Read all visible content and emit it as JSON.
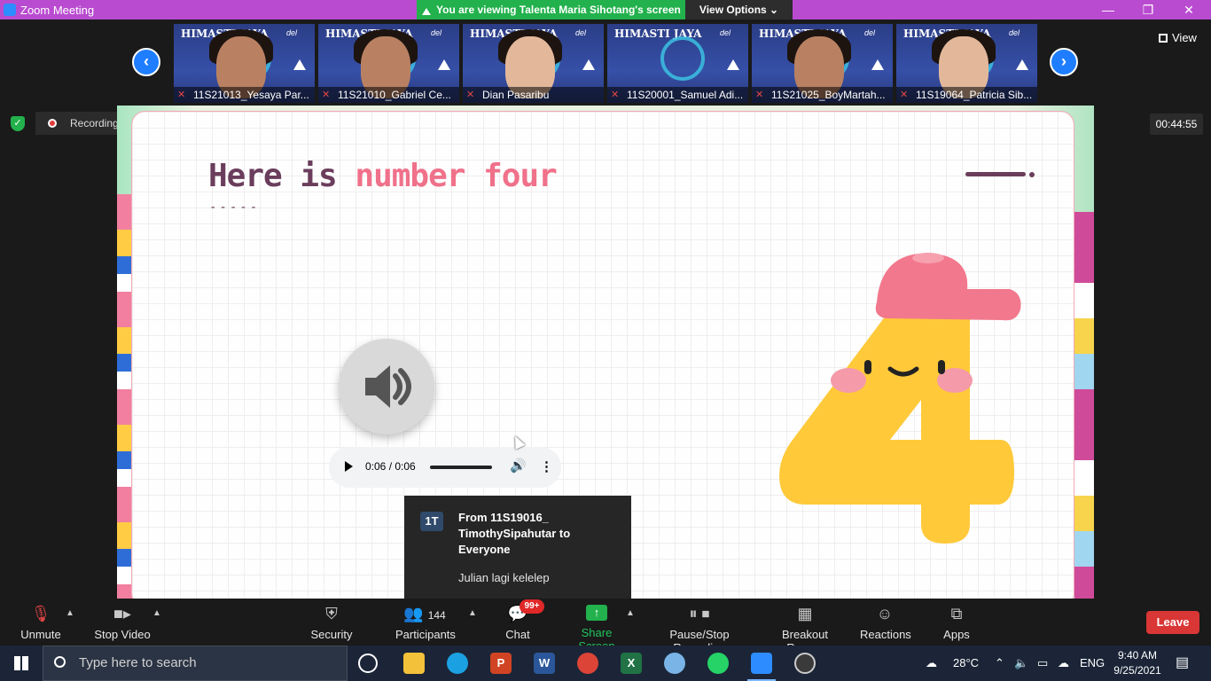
{
  "window": {
    "title": "Zoom Meeting"
  },
  "banner": {
    "sharing_text": "You are viewing Talenta Maria Sihotang's screen",
    "view_options": "View Options ⌄"
  },
  "view": {
    "label": "View"
  },
  "participants_strip": [
    {
      "name": "11S21013_Yesaya Par...",
      "has_person": true,
      "tone": "dark"
    },
    {
      "name": "11S21010_Gabriel Ce...",
      "has_person": true,
      "tone": "dark"
    },
    {
      "name": "Dian Pasaribu",
      "has_person": true,
      "tone": "light"
    },
    {
      "name": "11S20001_Samuel Adi...",
      "has_person": false,
      "tone": "none"
    },
    {
      "name": "11S21025_BoyMartah...",
      "has_person": true,
      "tone": "dark"
    },
    {
      "name": "11S19064_Patricia Sib...",
      "has_person": true,
      "tone": "light"
    }
  ],
  "thumb_brand": "HIMASTI JAYA",
  "thumb_del": "del",
  "recording": {
    "label": "Recording...",
    "timer": "00:44:55"
  },
  "slide": {
    "title_prefix": "Here is",
    "title_accent": "number four",
    "dashes": "-----",
    "audio": {
      "time": "0:06 / 0:06"
    }
  },
  "chat_popup": {
    "avatar": "1T",
    "from": "From 11S19016_ TimothySipahutar to Everyone",
    "message": "Julian lagi kelelep"
  },
  "toolbar": {
    "unmute": "Unmute",
    "stop_video": "Stop Video",
    "security": "Security",
    "participants": "Participants",
    "participants_count": "144",
    "chat": "Chat",
    "chat_badge": "99+",
    "share_screen": "Share Screen",
    "pause_stop_recording": "Pause/Stop Recording",
    "breakout_rooms": "Breakout Rooms",
    "reactions": "Reactions",
    "apps": "Apps",
    "leave": "Leave"
  },
  "taskbar": {
    "search_placeholder": "Type here to search",
    "weather": "28°C",
    "language": "ENG",
    "time": "9:40 AM",
    "date": "9/25/2021"
  },
  "colors": {
    "titlebar": "#b94bd0",
    "share_green": "#22b14c",
    "leave_red": "#d93636",
    "slide_title": "#6b3d5c",
    "slide_accent": "#f0718a",
    "four_yellow": "#ffc93a",
    "cap_pink": "#f2788d"
  }
}
